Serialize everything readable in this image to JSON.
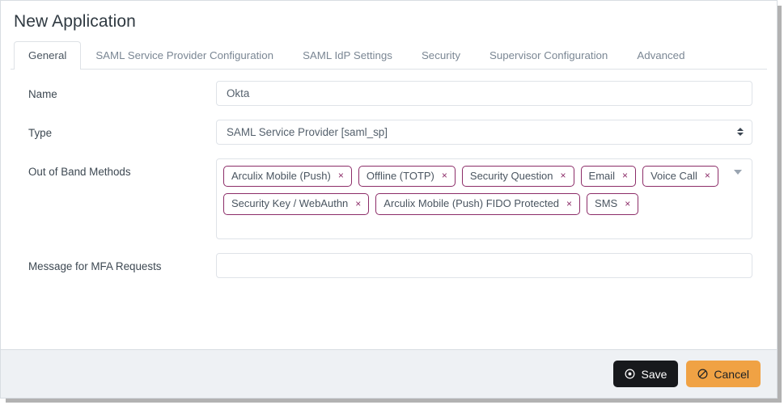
{
  "page": {
    "title": "New Application"
  },
  "tabs": [
    {
      "label": "General",
      "active": true
    },
    {
      "label": "SAML Service Provider Configuration",
      "active": false
    },
    {
      "label": "SAML IdP Settings",
      "active": false
    },
    {
      "label": "Security",
      "active": false
    },
    {
      "label": "Supervisor Configuration",
      "active": false
    },
    {
      "label": "Advanced",
      "active": false
    }
  ],
  "form": {
    "name": {
      "label": "Name",
      "value": "Okta",
      "placeholder": ""
    },
    "type": {
      "label": "Type",
      "value": "SAML Service Provider [saml_sp]"
    },
    "out_of_band_methods": {
      "label": "Out of Band Methods",
      "chips": [
        "Arculix Mobile (Push)",
        "Offline (TOTP)",
        "Security Question",
        "Email",
        "Voice Call",
        "Security Key / WebAuthn",
        "Arculix Mobile (Push) FIDO Protected",
        "SMS"
      ],
      "remove_glyph": "×",
      "chip_border_color": "#8c2c68"
    },
    "mfa_message": {
      "label": "Message for MFA Requests",
      "value": "",
      "placeholder": ""
    }
  },
  "footer": {
    "save_label": "Save",
    "cancel_label": "Cancel",
    "save_bg": "#17191c",
    "cancel_bg": "#f0a244"
  }
}
